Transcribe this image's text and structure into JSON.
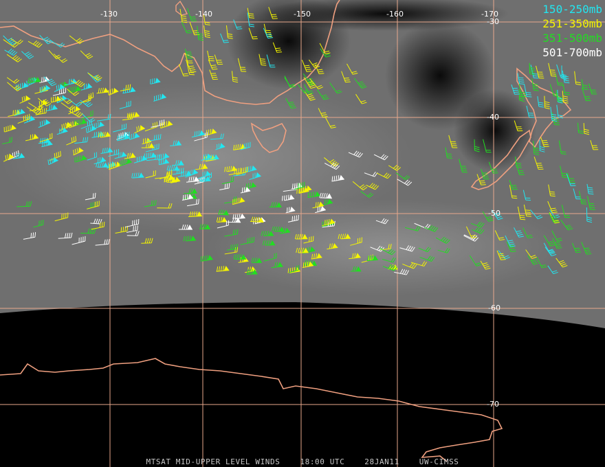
{
  "caption": {
    "product": "MTSAT MID-UPPER LEVEL WINDS",
    "time": "18:00 UTC",
    "date": "28JAN11",
    "credit": "UW-CIMSS"
  },
  "legend": [
    {
      "label": "150-250mb",
      "color": "#22e6f0"
    },
    {
      "label": "251-350mb",
      "color": "#f5f500"
    },
    {
      "label": "351-500mb",
      "color": "#22dd22"
    },
    {
      "label": "501-700mb",
      "color": "#ffffff"
    }
  ],
  "grid": {
    "longitudes": [
      "-130",
      "-140",
      "-150",
      "-160",
      "-170"
    ],
    "latitudes": [
      "-30",
      "-40",
      "-50",
      "-60",
      "-70"
    ],
    "line_color": "#e8a88c"
  },
  "colors": {
    "coastline": "#f0a080",
    "space": "#000000"
  }
}
